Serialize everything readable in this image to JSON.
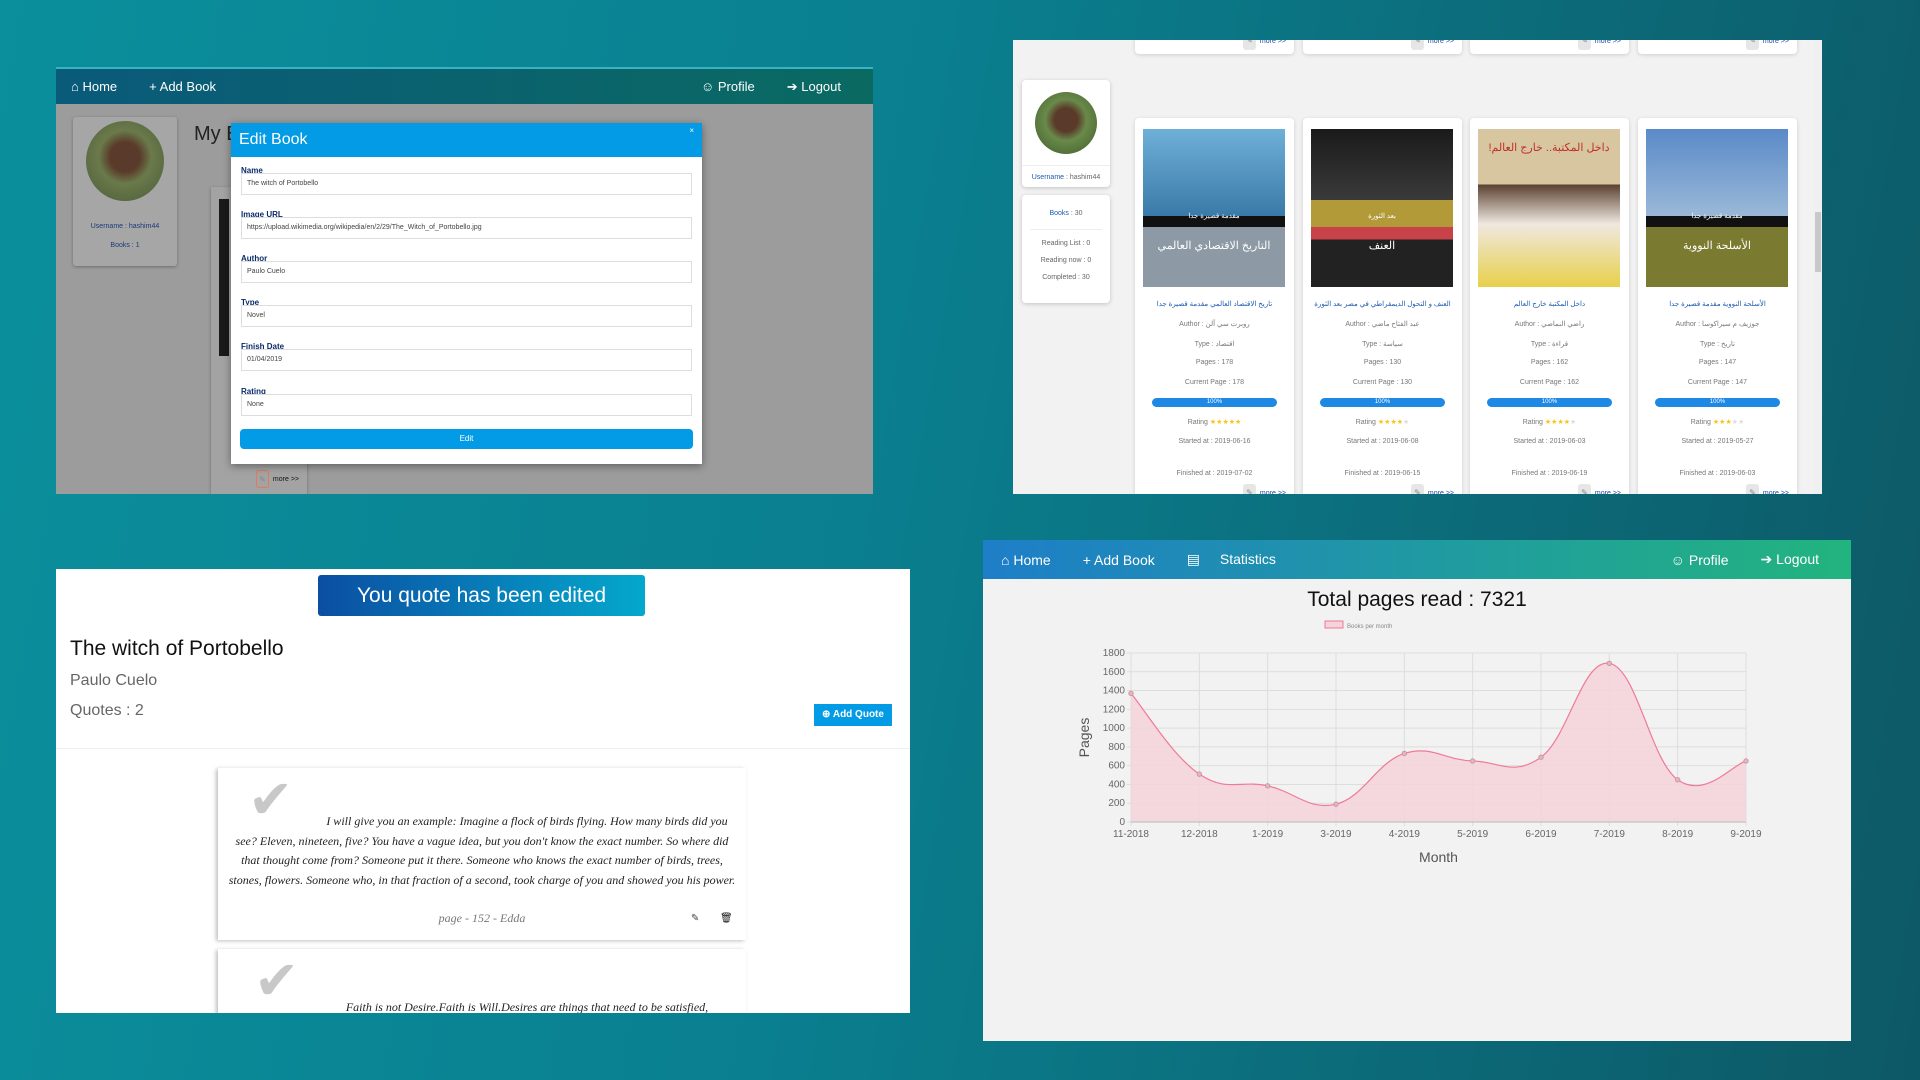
{
  "colors": {
    "accent": "#039be5",
    "navbar_gradient": [
      "#0d5e8c",
      "#0a7a5e"
    ],
    "stats_navbar": [
      "#1e7ec8",
      "#22b47e"
    ],
    "toast": [
      "#0b4ea2",
      "#04a8cc"
    ],
    "chart_line": "#f07a96",
    "chart_fill": "#f5d3db"
  },
  "edit_panel": {
    "nav": {
      "home": "Home",
      "add_book": "Add Book",
      "profile": "Profile",
      "logout": "Logout"
    },
    "profile": {
      "username": "Username : hashim44",
      "books": "Books : 1"
    },
    "page_heading": "My B",
    "modal": {
      "title": "Edit Book",
      "close": "×",
      "fields": [
        {
          "label": "Name",
          "value": "The witch of Portobello"
        },
        {
          "label": "Image URL",
          "value": "https://upload.wikimedia.org/wikipedia/en/2/29/The_Witch_of_Portobello.jpg"
        },
        {
          "label": "Author",
          "value": "Paulo Cuelo"
        },
        {
          "label": "Type",
          "value": "Novel"
        },
        {
          "label": "Finish Date",
          "value": "01/04/2019"
        },
        {
          "label": "Rating",
          "value": "None"
        }
      ],
      "submit": "Edit"
    },
    "more": "more >>"
  },
  "books_panel": {
    "profile": {
      "username_label": "Username",
      "username": " : hashim44"
    },
    "stats": {
      "books_label": "Books",
      "books": " : 30",
      "reading_list": "Reading List : 0",
      "reading_now": "Reading now : 0",
      "completed": "Completed : 30"
    },
    "more": "more >>",
    "books": [
      {
        "title": "تاريخ الاقتصاد العالمي مقدمة قصيرة جدا",
        "author": "Author : روبرت سي آلن",
        "type": "Type : اقتصاد",
        "pages": "Pages : 178",
        "current": "Current Page : 178",
        "progress": "100%",
        "progress_value": 100,
        "rating_label": "Rating",
        "rating": 5,
        "started": "Started at : 2019-06-16",
        "finished": "Finished at : 2019-07-02",
        "cover_title": "التاريخ الاقتصادي العالمي",
        "cover_series": "مقدمة قصيرة جدا"
      },
      {
        "title": "العنف و التحول الديمقراطي في مصر بعد الثورة",
        "author": "Author : عبد الفتاح ماضي",
        "type": "Type : سياسة",
        "pages": "Pages : 130",
        "current": "Current Page : 130",
        "progress": "100%",
        "progress_value": 100,
        "rating_label": "Rating",
        "rating": 4,
        "started": "Started at : 2019-06-08",
        "finished": "Finished at : 2019-06-15",
        "cover_title": "العنف",
        "cover_series": "بعد الثورة"
      },
      {
        "title": "داخل المكتبة خارج العالم",
        "author": "Author : راضي النماصي",
        "type": "Type : قراءة",
        "pages": "Pages : 162",
        "current": "Current Page : 162",
        "progress": "100%",
        "progress_value": 100,
        "rating_label": "Rating",
        "rating": 4,
        "started": "Started at : 2019-06-03",
        "finished": "Finished at : 2019-06-19",
        "cover_title": "داخل المكتبة.. خارج العالم!",
        "cover_series": ""
      },
      {
        "title": "الأسلحة النووية مقدمة قصيرة جدا",
        "author": "Author : جوزيف م سيراكوسا",
        "type": "Type : تاريخ",
        "pages": "Pages : 147",
        "current": "Current Page : 147",
        "progress": "100%",
        "progress_value": 100,
        "rating_label": "Rating",
        "rating": 3,
        "started": "Started at : 2019-05-27",
        "finished": "Finished at : 2019-06-03",
        "cover_title": "الأسلحة النووية",
        "cover_series": "مقدمة قصيرة جدا"
      }
    ]
  },
  "quotes_panel": {
    "toast": "You quote has been edited",
    "book_title": "The witch of Portobello",
    "author": "Paulo Cuelo",
    "quotes_count": "Quotes : 2",
    "add_quote": "Add Quote",
    "quotes": [
      {
        "text": "I will give you an example: Imagine a flock of birds flying. How many birds did you see? Eleven, nineteen, five? You have a vague idea, but you don't know the exact number. So where did that thought come from? Someone put it there. Someone who knows the exact number of birds, trees, stones, flowers. Someone who, in that fraction of a second, took charge of you and showed you his power.",
        "meta": "page - 152 - Edda"
      },
      {
        "text": "Faith is not Desire.Faith is Will.Desires are things that need to be satisfied,",
        "meta": ""
      }
    ]
  },
  "stats_panel": {
    "nav": {
      "home": "Home",
      "add_book": "Add Book",
      "statistics": "Statistics",
      "profile": "Profile",
      "logout": "Logout"
    },
    "heading": "Total pages read : 7321"
  },
  "chart_data": {
    "type": "area",
    "title": "",
    "xlabel": "Month",
    "ylabel": "Pages",
    "categories": [
      "11-2018",
      "12-2018",
      "1-2019",
      "3-2019",
      "4-2019",
      "5-2019",
      "6-2019",
      "7-2019",
      "8-2019",
      "9-2019"
    ],
    "series": [
      {
        "name": "Books per month",
        "values": [
          1370,
          510,
          385,
          190,
          730,
          650,
          690,
          1690,
          450,
          650
        ]
      }
    ],
    "ylim": [
      0,
      1800
    ],
    "yticks": [
      0,
      200,
      400,
      600,
      800,
      1000,
      1200,
      1400,
      1600,
      1800
    ],
    "grid": true,
    "legend": "top",
    "smooth": true
  }
}
